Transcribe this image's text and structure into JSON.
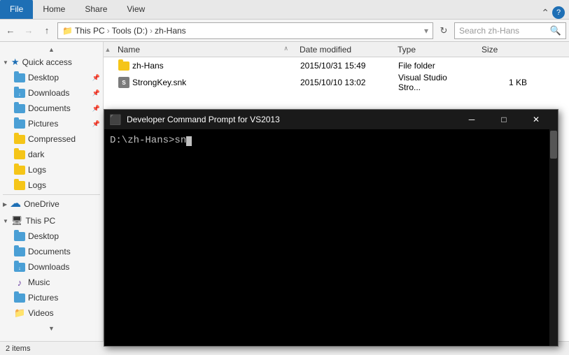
{
  "ribbon": {
    "tabs": [
      "File",
      "Home",
      "Share",
      "View"
    ],
    "active_tab": "File"
  },
  "address": {
    "back_enabled": true,
    "forward_enabled": false,
    "up_enabled": true,
    "breadcrumb": [
      "This PC",
      "Tools (D:)",
      "zh-Hans"
    ],
    "search_placeholder": "Search zh-Hans",
    "refresh_title": "Refresh"
  },
  "sidebar": {
    "quick_access_label": "Quick access",
    "items_quick": [
      {
        "label": "Desktop",
        "pinned": true
      },
      {
        "label": "Downloads",
        "pinned": true
      },
      {
        "label": "Documents",
        "pinned": true
      },
      {
        "label": "Pictures",
        "pinned": true
      }
    ],
    "items_extra": [
      {
        "label": "Compressed"
      },
      {
        "label": "dark"
      },
      {
        "label": "Logs"
      },
      {
        "label": "Logs"
      }
    ],
    "onedrive_label": "OneDrive",
    "this_pc_label": "This PC",
    "items_this_pc": [
      {
        "label": "Desktop"
      },
      {
        "label": "Documents"
      },
      {
        "label": "Downloads"
      },
      {
        "label": "Music"
      },
      {
        "label": "Pictures"
      },
      {
        "label": "Videos"
      }
    ]
  },
  "file_list": {
    "columns": {
      "name": "Name",
      "date_modified": "Date modified",
      "type": "Type",
      "size": "Size"
    },
    "files": [
      {
        "name": "zh-Hans",
        "date": "2015/10/31 15:49",
        "type": "File folder",
        "size": "",
        "is_folder": true
      },
      {
        "name": "StrongKey.snk",
        "date": "2015/10/10 13:02",
        "type": "Visual Studio Stro...",
        "size": "1 KB",
        "is_folder": false
      }
    ]
  },
  "cmd_window": {
    "title": "Developer Command Prompt for VS2013",
    "prompt_text": "D:\\zh-Hans>sn",
    "cursor_visible": true,
    "buttons": {
      "minimize": "─",
      "maximize": "□",
      "close": "✕"
    }
  }
}
